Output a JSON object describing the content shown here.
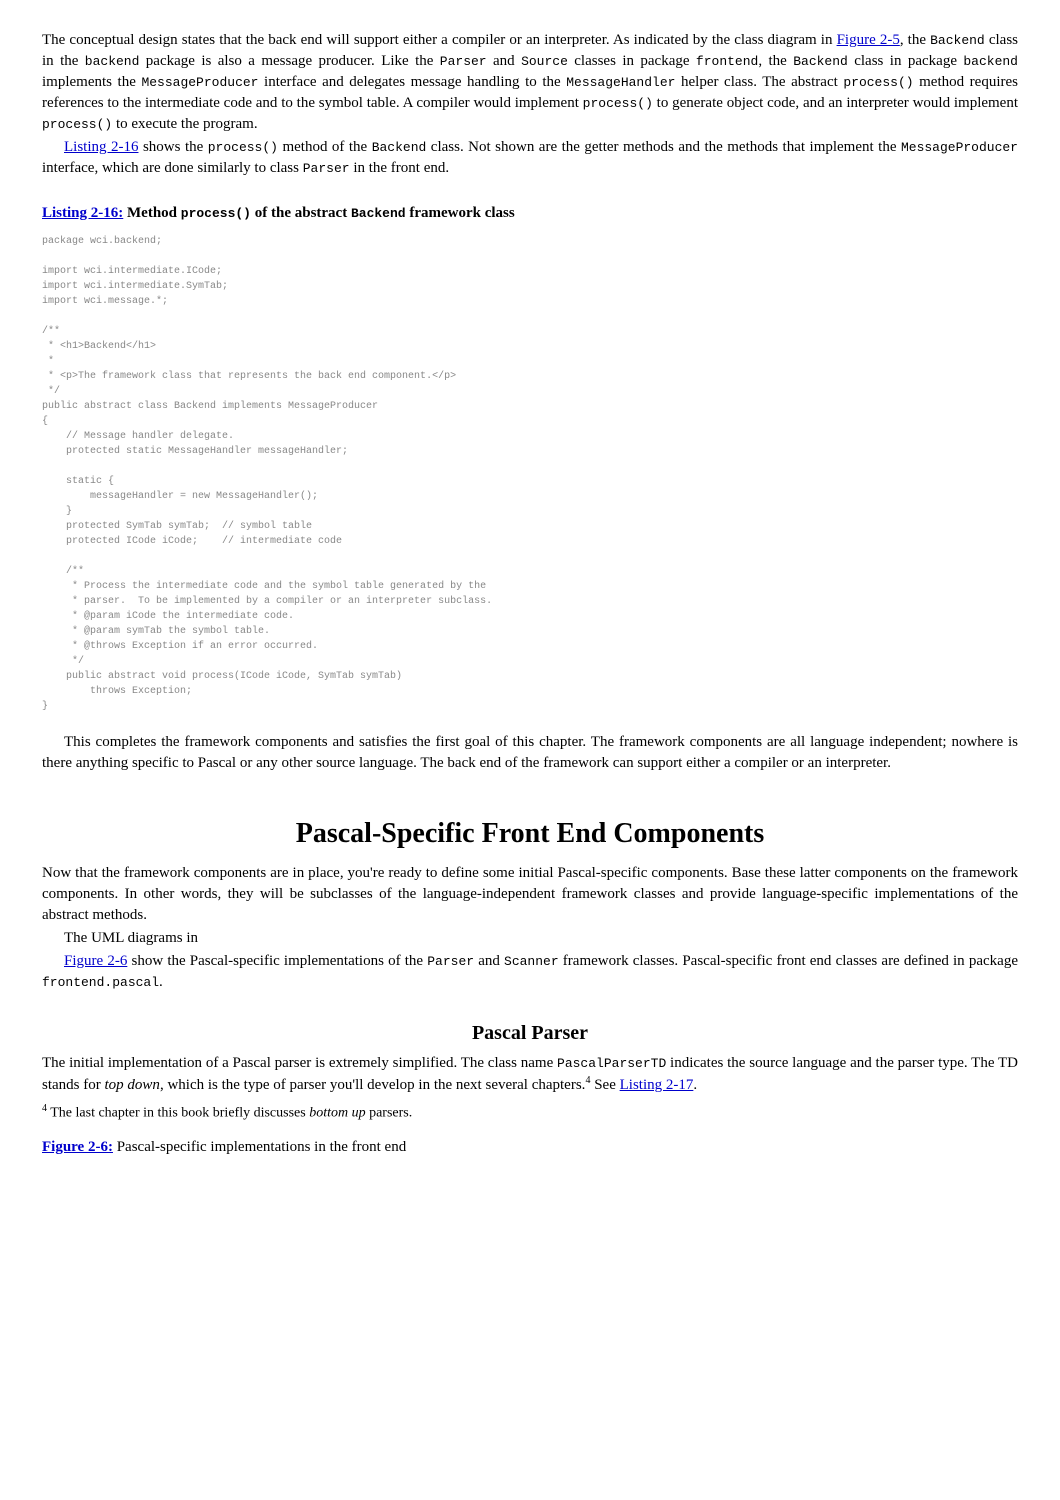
{
  "para1": {
    "s1a": "The conceptual design states that the back end will support either a compiler or an interpreter. As indicated by the class diagram in ",
    "link1": "Figure 2-5",
    "s1b": ", the ",
    "c1": "Backend",
    "s1c": " class in the ",
    "c2": "backend",
    "s1d": " package is also a message producer. Like the ",
    "c3": "Parser",
    "s1e": " and ",
    "c4": "Source",
    "s1f": " classes in package ",
    "c5": "frontend",
    "s1g": ", the ",
    "c6": "Backend",
    "s1h": " class in package ",
    "c7": "backend",
    "s1i": " implements the ",
    "c8": "MessageProducer",
    "s1j": " interface and delegates message handling to the ",
    "c9": "MessageHandler",
    "s1k": " helper class. The abstract ",
    "c10": "process()",
    "s1l": " method requires references to the intermediate code and to the symbol table. A compiler would implement ",
    "c11": "process()",
    "s1m": " to generate object code, and an interpreter would implement ",
    "c12": "process()",
    "s1n": " to execute the program."
  },
  "para2": {
    "link": "Listing 2-16",
    "s2a": " shows the ",
    "c1": "process()",
    "s2b": " method of the ",
    "c2": "Backend",
    "s2c": " class. Not shown are the getter methods and the methods that implement the ",
    "c3": "MessageProducer",
    "s2d": " interface, which are done similarly to class ",
    "c4": "Parser",
    "s2e": " in the front end."
  },
  "listing_header": {
    "link": "Listing 2-16:",
    "t1": " Method ",
    "c1": "process()",
    "t2": " of the abstract ",
    "c2": "Backend",
    "t3": " framework class"
  },
  "code": "package wci.backend;\n\nimport wci.intermediate.ICode;\nimport wci.intermediate.SymTab;\nimport wci.message.*;\n\n/**\n * <h1>Backend</h1>\n *\n * <p>The framework class that represents the back end component.</p>\n */\npublic abstract class Backend implements MessageProducer\n{\n    // Message handler delegate.\n    protected static MessageHandler messageHandler;\n\n    static {\n        messageHandler = new MessageHandler();\n    }\n    protected SymTab symTab;  // symbol table\n    protected ICode iCode;    // intermediate code\n\n    /**\n     * Process the intermediate code and the symbol table generated by the\n     * parser.  To be implemented by a compiler or an interpreter subclass.\n     * @param iCode the intermediate code.\n     * @param symTab the symbol table.\n     * @throws Exception if an error occurred.\n     */\n    public abstract void process(ICode iCode, SymTab symTab)\n        throws Exception;\n}",
  "para3": "This completes the framework components and satisfies the first goal of this chapter. The framework components are all language independent; nowhere is there anything specific to Pascal or any other source language. The back end of the framework can support either a compiler or an interpreter.",
  "section_title": "Pascal-Specific Front End Components",
  "para4": "Now that the framework components are in place, you're ready to define some initial Pascal-specific components. Base these latter components on the framework components. In other words, they will be subclasses of the language-independent framework classes and provide language-specific implementations of the abstract methods.",
  "para5": "The UML diagrams in",
  "para6": {
    "link": "Figure 2-6",
    "s1": " show the Pascal-specific implementations of the ",
    "c1": "Parser",
    "s2": " and ",
    "c2": "Scanner",
    "s3": " framework classes. Pascal-specific front end classes are defined in package ",
    "c3": "frontend.pascal",
    "s4": "."
  },
  "subsection_title": "Pascal Parser",
  "para7": {
    "s1": "The initial implementation of a Pascal parser is extremely simplified. The class name ",
    "c1": "PascalParserTD",
    "s2": " indicates the source language and the parser type. The TD stands for ",
    "em": "top down",
    "s3": ", which is the type of parser you'll develop in the next several chapters.",
    "sup": "4",
    "s4": " See ",
    "link": "Listing 2-17",
    "s5": "."
  },
  "footnote": {
    "sup": "4",
    "s1": " The last chapter in this book briefly discusses ",
    "em": "bottom up",
    "s2": " parsers."
  },
  "figcap": {
    "link": "Figure 2-6:",
    "text": " Pascal-specific implementations in the front end"
  }
}
